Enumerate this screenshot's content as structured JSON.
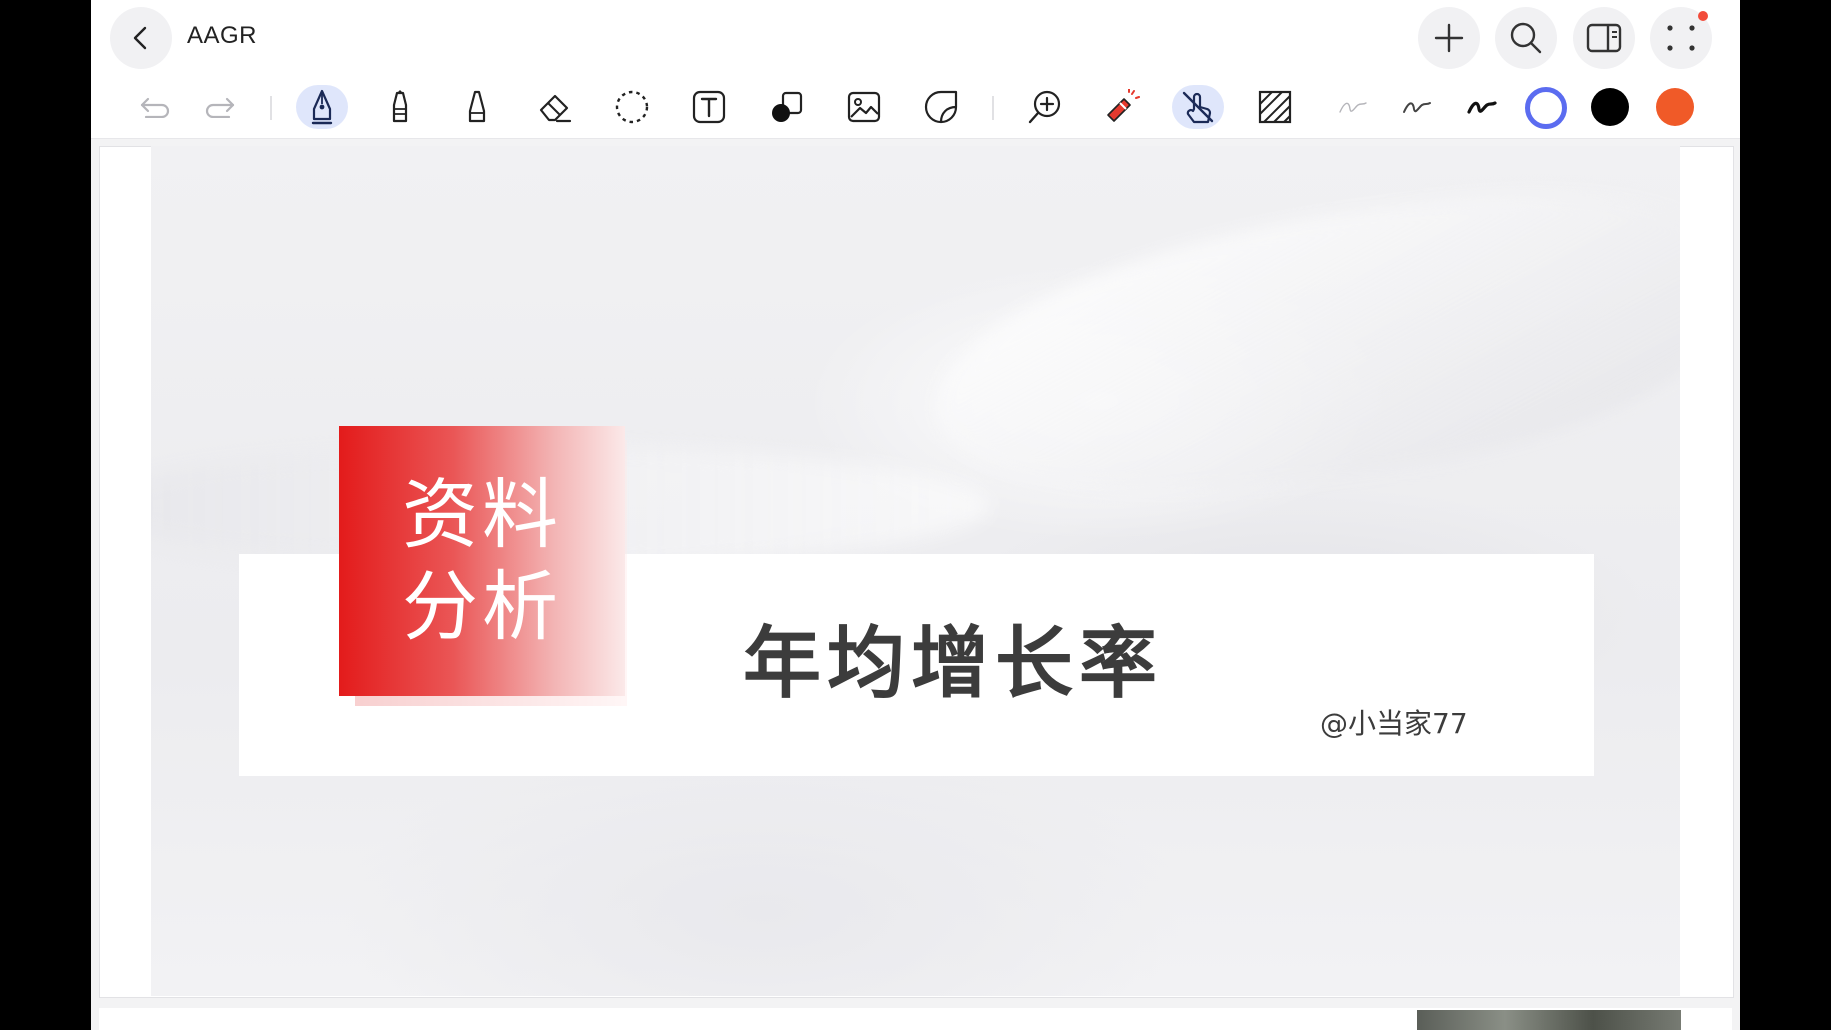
{
  "header": {
    "title": "AAGR"
  },
  "icons": {
    "back": "chevron-left-icon",
    "add": "plus-icon",
    "search": "search-icon",
    "panel": "sidebar-panel-icon",
    "more": "more-dots-icon"
  },
  "toolbar": {
    "tools": [
      "undo",
      "redo",
      "fountain-pen",
      "marker",
      "highlighter",
      "eraser",
      "lasso",
      "text",
      "shapes",
      "image",
      "sticker",
      "zoom-in",
      "laser-pointer",
      "touch-draw",
      "hatch-fill"
    ],
    "active_tools": [
      "fountain-pen",
      "touch-draw"
    ],
    "stroke_widths": [
      "thin",
      "medium",
      "thick"
    ],
    "colors": [
      "#5b6cf0",
      "#000000",
      "#f05a28"
    ],
    "selected_color": "#5b6cf0"
  },
  "slide": {
    "badge_line1": "资料",
    "badge_line2": "分析",
    "title": "年均增长率",
    "author": "@小当家77"
  },
  "colors": {
    "accent_red": "#e31b1b",
    "active_tool_bg": "#dfe6fb",
    "notification_dot": "#f24b3a"
  }
}
